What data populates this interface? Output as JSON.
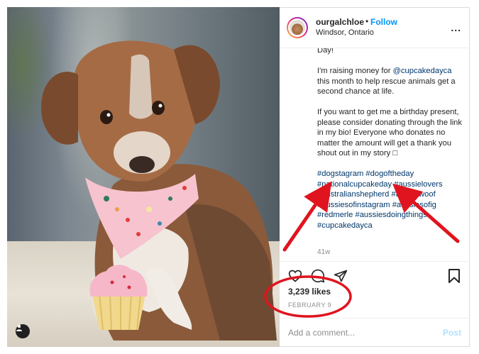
{
  "post": {
    "username": "ourgalchloe",
    "separator": "•",
    "follow_label": "Follow",
    "location": "Windsor, Ontario",
    "more_label": "...",
    "caption": {
      "line_top": "Day!",
      "para1_prefix": "I'm raising money for ",
      "para1_mention": "@cupcakedayca",
      "para1_suffix": " this month to help rescue animals get a second chance at life.",
      "para2": "If you want to get me a birthday present, please consider donating through the link in my bio! Everyone who donates no matter the amount will get a thank you shout out in my story □",
      "hashtags": "#dogstagram #dogoftheday #nationalcupcakeday #aussielovers #australianshepherd #aussiewoof #aussiesofinstagram #aussiesofig #redmerle #aussiesdoingthings #cupcakedayca"
    },
    "time_ago": "41w",
    "likes": "3,239 likes",
    "date": "FEBRUARY 9",
    "comment_placeholder": "Add a comment...",
    "post_label": "Post"
  },
  "icons": {
    "like": "heart-icon",
    "comment": "comment-icon",
    "share": "paper-plane-icon",
    "save": "bookmark-icon",
    "tag": "user-tag-icon",
    "more": "more-options-icon"
  },
  "colors": {
    "follow": "#0095f6",
    "hashtag": "#00376b",
    "annotation": "#e0141e",
    "post_disabled": "#b2dffc"
  }
}
